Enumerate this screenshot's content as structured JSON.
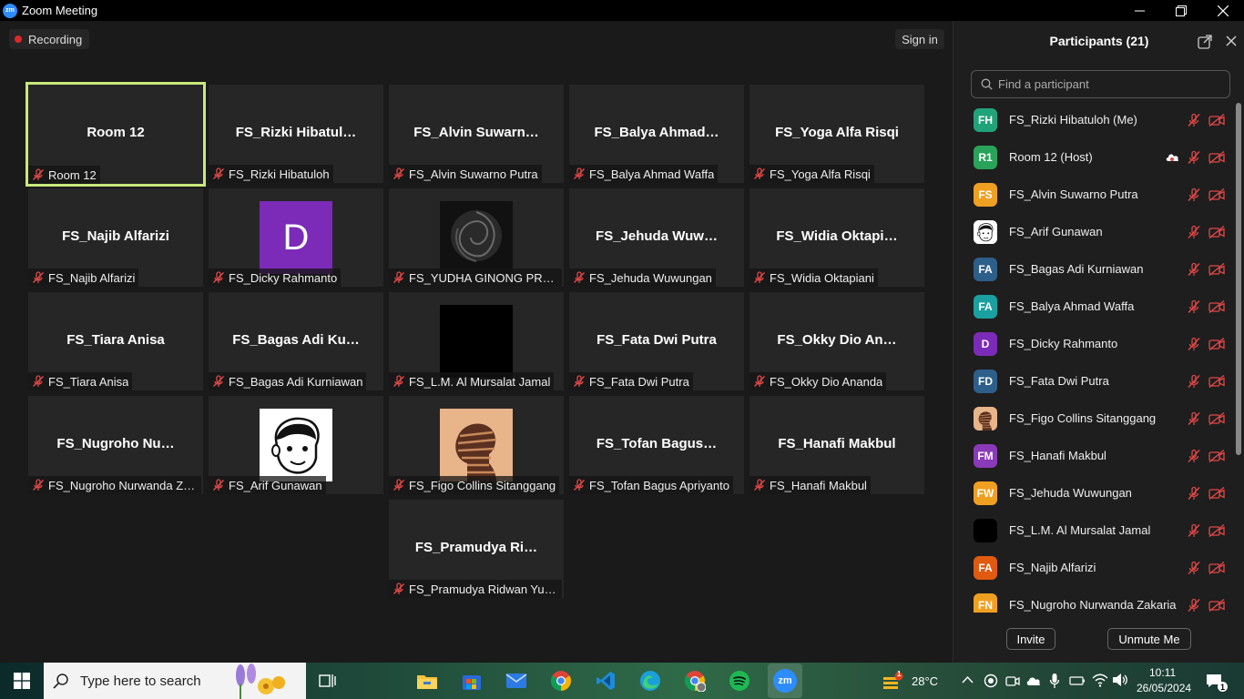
{
  "window": {
    "title": "Zoom Meeting",
    "app_icon": "zm",
    "controls": [
      "minimize",
      "restore",
      "close"
    ]
  },
  "meeting": {
    "recording_label": "Recording",
    "sign_in_label": "Sign in",
    "tiles": [
      {
        "display": "Room 12",
        "label": "Room 12",
        "active": true
      },
      {
        "display": "FS_Rizki  Hibatul…",
        "label": "FS_Rizki Hibatuloh"
      },
      {
        "display": "FS_Alvin  Suwarn…",
        "label": "FS_Alvin Suwarno Putra"
      },
      {
        "display": "FS_Balya  Ahmad…",
        "label": "FS_Balya Ahmad Waffa"
      },
      {
        "display": "FS_Yoga Alfa Risqi",
        "label": "FS_Yoga Alfa Risqi"
      },
      {
        "display": "FS_Najib Alfarizi",
        "label": "FS_Najib Alfarizi"
      },
      {
        "display": "",
        "label": "FS_Dicky Rahmanto",
        "picture": "letter-D"
      },
      {
        "display": "",
        "label": "FS_YUDHA GINONG PRATI...",
        "picture": "black-rose"
      },
      {
        "display": "FS_Jehuda  Wuw…",
        "label": "FS_Jehuda Wuwungan"
      },
      {
        "display": "FS_Widia  Oktapi…",
        "label": "FS_Widia Oktapiani"
      },
      {
        "display": "FS_Tiara Anisa",
        "label": "FS_Tiara Anisa"
      },
      {
        "display": "FS_Bagas Adi Ku…",
        "label": "FS_Bagas Adi Kurniawan"
      },
      {
        "display": "",
        "label": "FS_L.M. Al Mursalat Jamal",
        "picture": "black"
      },
      {
        "display": "FS_Fata Dwi Putra",
        "label": "FS_Fata Dwi Putra"
      },
      {
        "display": "FS_Okky  Dio  An…",
        "label": "FS_Okky Dio Ananda"
      },
      {
        "display": "FS_Nugroho  Nu…",
        "label": "FS_Nugroho Nurwanda Za..."
      },
      {
        "display": "",
        "label": "FS_Arif Gunawan",
        "picture": "cartoon-face"
      },
      {
        "display": "",
        "label": "FS_Figo Collins Sitanggang",
        "picture": "silhouette"
      },
      {
        "display": "FS_Tofan  Bagus…",
        "label": "FS_Tofan Bagus Apriyanto"
      },
      {
        "display": "FS_Hanafi Makbul",
        "label": "FS_Hanafi Makbul"
      },
      {
        "display": "FS_Pramudya  Ri…",
        "label": "FS_Pramudya Ridwan Yulia..."
      }
    ],
    "picture_letter": "D"
  },
  "participants": {
    "title": "Participants (21)",
    "search_placeholder": "Find a participant",
    "list": [
      {
        "initials": "FH",
        "name": "FS_Rizki Hibatuloh (Me)",
        "color": "#21a37a"
      },
      {
        "initials": "R1",
        "name": "Room 12 (Host)",
        "color": "#2aa35a",
        "cloud": true
      },
      {
        "initials": "FS",
        "name": "FS_Alvin Suwarno Putra",
        "color": "#f0a020"
      },
      {
        "initials": "",
        "name": "FS_Arif Gunawan",
        "color": "#ffffff",
        "picture": "cartoon-face"
      },
      {
        "initials": "FA",
        "name": "FS_Bagas Adi Kurniawan",
        "color": "#2d5f8a"
      },
      {
        "initials": "FA",
        "name": "FS_Balya Ahmad Waffa",
        "color": "#1aa0a0"
      },
      {
        "initials": "D",
        "name": "FS_Dicky Rahmanto",
        "color": "#7b2bb8"
      },
      {
        "initials": "FD",
        "name": "FS_Fata Dwi Putra",
        "color": "#2d5f8a"
      },
      {
        "initials": "",
        "name": "FS_Figo Collins Sitanggang",
        "color": "#c98a5a",
        "picture": "silhouette"
      },
      {
        "initials": "FM",
        "name": "FS_Hanafi Makbul",
        "color": "#8a3ab8"
      },
      {
        "initials": "FW",
        "name": "FS_Jehuda Wuwungan",
        "color": "#f0a020"
      },
      {
        "initials": "",
        "name": "FS_L.M. Al Mursalat Jamal",
        "color": "#000000"
      },
      {
        "initials": "FA",
        "name": "FS_Najib Alfarizi",
        "color": "#e05a10"
      },
      {
        "initials": "FN",
        "name": "FS_Nugroho Nurwanda Zakaria",
        "color": "#f0a020"
      }
    ],
    "invite_label": "Invite",
    "unmute_label": "Unmute Me"
  },
  "taskbar": {
    "search_placeholder": "Type here to search",
    "weather": "28°C",
    "weather_badge": "1",
    "time": "10:11",
    "date": "26/05/2024",
    "notification_count": "1",
    "apps": [
      "task-view",
      "file-explorer",
      "microsoft-store",
      "mail",
      "chrome",
      "vscode",
      "edge",
      "chrome-profile",
      "spotify",
      "zoom"
    ]
  }
}
